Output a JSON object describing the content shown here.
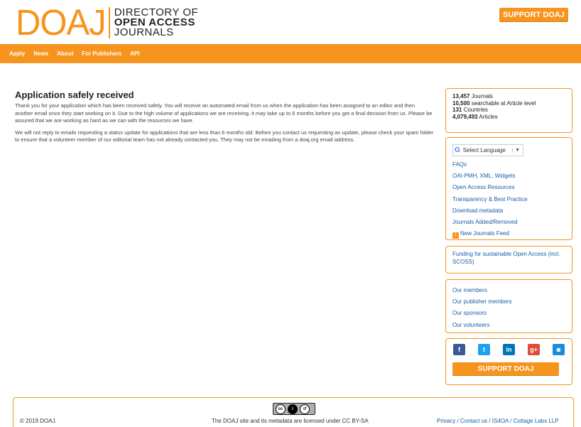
{
  "header": {
    "logo_mark": "DOAJ",
    "logo_line1": "DIRECTORY OF",
    "logo_line2": "OPEN ACCESS",
    "logo_line3": "JOURNALS",
    "support_label": "SUPPORT DOAJ"
  },
  "nav": {
    "items": [
      "Apply",
      "News",
      "About",
      "For Publishers",
      "API"
    ]
  },
  "main": {
    "title": "Application safely received",
    "paragraph1": "Thank you for your application which has been received safely. You will receive an automated email from us when the application has been assigned to an editor and then another email once they start working on it. Due to the high volume of applications we are receiving, it may take up to 6 months before you get a final decision from us. Please be assured that we are working as hard as we can with the resources we have.",
    "paragraph2": "We will not reply to emails requesting a status update for applications that are less than 6 months old. Before you contact us requesting an update, please check your spam folder to ensure that a volunteer member of our editorial team has not already contacted you. They may not be emailing from a doaj.org email address."
  },
  "stats": {
    "journals_count": "13,457",
    "journals_label": " Journals",
    "searchable_count": "10,500",
    "searchable_label": " searchable at Article level",
    "countries_count": "131",
    "countries_label": " Countries",
    "articles_count": "4,079,493",
    "articles_label": " Articles"
  },
  "sidebar": {
    "language_label": "Select Language",
    "language_arrow": "▼",
    "links": [
      "FAQs",
      "OAI-PMH, XML, Widgets",
      "Open Access Resources",
      "Transparency & Best Practice",
      "Download metadata",
      "Journals Added/Removed"
    ],
    "feed_label": "New Journals Feed",
    "funding_label": "Funding for sustainable Open Access (incl. SCOSS)",
    "members": [
      "Our members",
      "Our publisher members",
      "Our sponsors",
      "Our volunteers"
    ],
    "support_label": "SUPPORT DOAJ",
    "social": [
      {
        "name": "facebook-icon",
        "glyph": "f",
        "color": "#3b5998"
      },
      {
        "name": "twitter-icon",
        "glyph": "t",
        "color": "#1da1f2"
      },
      {
        "name": "linkedin-icon",
        "glyph": "in",
        "color": "#0077b5"
      },
      {
        "name": "google-plus-icon",
        "glyph": "g+",
        "color": "#dd4b39"
      },
      {
        "name": "rss-feed-icon",
        "glyph": "◙",
        "color": "#1a8cd8"
      }
    ]
  },
  "footer": {
    "copyright": "© 2019 DOAJ.",
    "license": "The DOAJ site and its metadata are licensed under CC BY-SA",
    "links": "Privacy / Contact us / IS4OA / Cottage Labs LLP"
  },
  "colors": {
    "accent": "#f7941d",
    "link": "#1a5ea8"
  }
}
